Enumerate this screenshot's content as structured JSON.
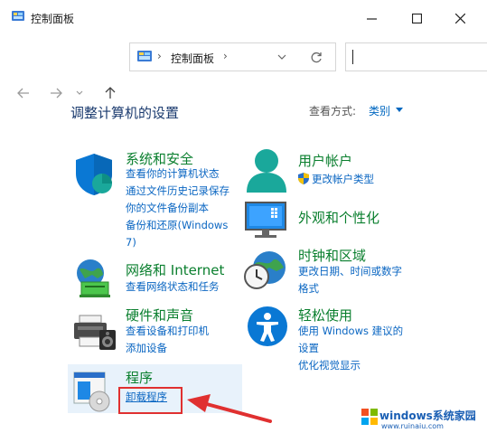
{
  "window": {
    "title": "控制面板",
    "minimize": "—",
    "maximize": "□",
    "close": "✕"
  },
  "address": {
    "breadcrumb_sep": "›",
    "location": "控制面板",
    "chevron": "›"
  },
  "main": {
    "heading": "调整计算机的设置",
    "view_by_label": "查看方式:",
    "view_by_value": "类别"
  },
  "categories": {
    "system": {
      "title": "系统和安全",
      "links": [
        "查看你的计算机状态",
        "通过文件历史记录保存",
        "你的文件备份副本",
        "备份和还原(Windows",
        "7)"
      ]
    },
    "network": {
      "title": "网络和 Internet",
      "links": [
        "查看网络状态和任务"
      ]
    },
    "hardware": {
      "title": "硬件和声音",
      "links": [
        "查看设备和打印机",
        "添加设备"
      ]
    },
    "programs": {
      "title": "程序",
      "links": [
        "卸载程序"
      ]
    },
    "user": {
      "title": "用户帐户",
      "links": [
        "更改帐户类型"
      ]
    },
    "appearance": {
      "title": "外观和个性化"
    },
    "clock": {
      "title": "时钟和区域",
      "links": [
        "更改日期、时间或数字",
        "格式"
      ]
    },
    "ease": {
      "title": "轻松使用",
      "links": [
        "使用 Windows 建议的",
        "设置",
        "优化视觉显示"
      ]
    }
  },
  "watermark": {
    "brand": "windows系统家园",
    "url": "www.ruinaiu.com"
  },
  "colors": {
    "category_title": "#0a7f2e",
    "link": "#0a66c2",
    "annotation_red": "#e03030"
  }
}
